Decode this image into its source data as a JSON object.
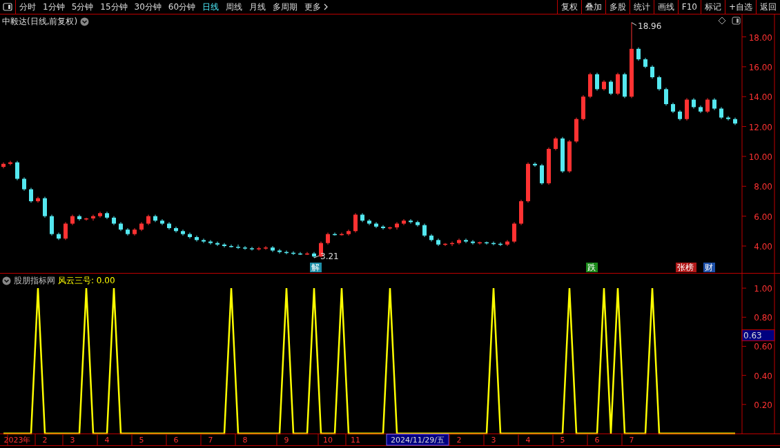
{
  "toolbar": {
    "periods": [
      {
        "label": "分时",
        "selected": false
      },
      {
        "label": "1分钟",
        "selected": false
      },
      {
        "label": "5分钟",
        "selected": false
      },
      {
        "label": "15分钟",
        "selected": false
      },
      {
        "label": "30分钟",
        "selected": false
      },
      {
        "label": "60分钟",
        "selected": false
      },
      {
        "label": "日线",
        "selected": true
      },
      {
        "label": "周线",
        "selected": false
      },
      {
        "label": "月线",
        "selected": false
      },
      {
        "label": "多周期",
        "selected": false
      }
    ],
    "more": "更多",
    "actions": [
      "复权",
      "叠加",
      "多股",
      "统计",
      "画线",
      "F10",
      "标记",
      "+自选",
      "返回"
    ]
  },
  "price_panel": {
    "title": "中毅达(日线,前复权)",
    "events": [
      {
        "text": "解",
        "color": "#1e8fa8"
      },
      {
        "text": "跌",
        "color": "#1a8a1a"
      },
      {
        "text": "张榜",
        "color": "#b01818"
      },
      {
        "text": "财",
        "color": "#1c4fa8"
      }
    ],
    "chart_data": {
      "type": "candlestick",
      "categories": [
        null,
        null,
        null,
        null,
        null,
        null,
        null,
        null,
        null,
        null,
        null,
        null,
        null,
        null,
        null,
        null,
        null,
        null,
        null,
        null,
        null,
        null,
        null,
        null,
        null,
        null,
        null,
        null,
        null,
        null,
        null,
        null,
        null,
        null,
        null,
        null,
        null,
        null,
        null,
        null,
        null,
        null,
        null,
        null,
        null,
        null,
        null,
        null,
        null,
        null,
        null,
        null,
        null,
        null,
        null,
        null,
        null,
        null,
        null,
        null,
        null,
        null,
        null,
        null,
        null,
        null,
        null,
        null,
        null,
        null,
        null,
        null,
        null,
        null,
        null,
        null,
        null,
        null,
        null,
        null,
        null,
        null,
        null,
        null,
        null,
        null,
        null,
        null,
        null,
        null,
        null,
        null,
        null,
        null,
        null,
        null,
        null,
        null,
        null,
        null,
        null,
        null,
        null,
        null,
        null,
        null,
        null
      ],
      "ohlc": [
        [
          9.3,
          9.6,
          9.2,
          9.5
        ],
        [
          9.5,
          9.7,
          9.4,
          9.6
        ],
        [
          9.6,
          9.7,
          8.4,
          8.5
        ],
        [
          8.5,
          8.6,
          7.7,
          7.8
        ],
        [
          7.8,
          7.9,
          6.9,
          7
        ],
        [
          7,
          7.3,
          6.9,
          7.2
        ],
        [
          7.2,
          7.3,
          5.9,
          6
        ],
        [
          6,
          6.1,
          4.7,
          4.8
        ],
        [
          4.8,
          4.9,
          4.4,
          4.5
        ],
        [
          4.5,
          5.6,
          4.4,
          5.5
        ],
        [
          5.5,
          6.1,
          5.4,
          6
        ],
        [
          6,
          6.1,
          5.7,
          5.8
        ],
        [
          5.8,
          5.9,
          5.7,
          5.85
        ],
        [
          5.85,
          6.1,
          5.7,
          6
        ],
        [
          6,
          6.3,
          5.9,
          6.2
        ],
        [
          6.2,
          6.3,
          5.8,
          5.9
        ],
        [
          5.9,
          6,
          5.4,
          5.5
        ],
        [
          5.5,
          5.6,
          5,
          5.1
        ],
        [
          5.1,
          5.2,
          4.7,
          4.8
        ],
        [
          4.8,
          5.2,
          4.7,
          5.1
        ],
        [
          5.1,
          5.6,
          5,
          5.5
        ],
        [
          5.5,
          6.1,
          5.4,
          6
        ],
        [
          6,
          6.1,
          5.6,
          5.7
        ],
        [
          5.7,
          5.8,
          5.4,
          5.5
        ],
        [
          5.5,
          5.6,
          5.1,
          5.2
        ],
        [
          5.2,
          5.3,
          4.9,
          5
        ],
        [
          5,
          5.1,
          4.7,
          4.8
        ],
        [
          4.8,
          4.9,
          4.5,
          4.6
        ],
        [
          4.6,
          4.7,
          4.3,
          4.4
        ],
        [
          4.4,
          4.5,
          4.2,
          4.3
        ],
        [
          4.3,
          4.4,
          4.1,
          4.2
        ],
        [
          4.2,
          4.3,
          4,
          4.1
        ],
        [
          4.1,
          4.2,
          3.9,
          4
        ],
        [
          4,
          4.1,
          3.9,
          3.95
        ],
        [
          3.95,
          4.1,
          3.8,
          3.9
        ],
        [
          3.9,
          4,
          3.75,
          3.85
        ],
        [
          3.85,
          3.95,
          3.7,
          3.8
        ],
        [
          3.8,
          3.95,
          3.7,
          3.85
        ],
        [
          3.85,
          4,
          3.75,
          3.9
        ],
        [
          3.9,
          4,
          3.6,
          3.7
        ],
        [
          3.7,
          3.8,
          3.5,
          3.6
        ],
        [
          3.6,
          3.7,
          3.45,
          3.55
        ],
        [
          3.55,
          3.65,
          3.4,
          3.5
        ],
        [
          3.5,
          3.6,
          3.4,
          3.45
        ],
        [
          3.45,
          3.6,
          3.4,
          3.5
        ],
        [
          3.5,
          3.6,
          3.21,
          3.3
        ],
        [
          3.3,
          4.3,
          3.25,
          4.2
        ],
        [
          4.2,
          4.9,
          4.1,
          4.8
        ],
        [
          4.8,
          4.9,
          4.7,
          4.75
        ],
        [
          4.75,
          4.9,
          4.7,
          4.8
        ],
        [
          4.8,
          5.1,
          4.7,
          5
        ],
        [
          5,
          6.2,
          4.9,
          6.1
        ],
        [
          6.1,
          6.2,
          5.6,
          5.7
        ],
        [
          5.7,
          5.8,
          5.4,
          5.5
        ],
        [
          5.5,
          5.6,
          5.2,
          5.3
        ],
        [
          5.3,
          5.4,
          5.1,
          5.2
        ],
        [
          5.2,
          5.3,
          5.1,
          5.25
        ],
        [
          5.25,
          5.6,
          5.1,
          5.5
        ],
        [
          5.5,
          5.8,
          5.4,
          5.7
        ],
        [
          5.7,
          5.8,
          5.5,
          5.6
        ],
        [
          5.6,
          5.7,
          5.3,
          5.4
        ],
        [
          5.4,
          5.5,
          4.6,
          4.7
        ],
        [
          4.7,
          4.8,
          4.3,
          4.4
        ],
        [
          4.4,
          4.5,
          4,
          4.1
        ],
        [
          4.1,
          4.2,
          4,
          4.15
        ],
        [
          4.15,
          4.3,
          4,
          4.2
        ],
        [
          4.2,
          4.5,
          4.1,
          4.4
        ],
        [
          4.4,
          4.5,
          4.2,
          4.3
        ],
        [
          4.3,
          4.4,
          4.1,
          4.2
        ],
        [
          4.2,
          4.3,
          4.1,
          4.25
        ],
        [
          4.25,
          4.3,
          4.1,
          4.2
        ],
        [
          4.2,
          4.3,
          4.05,
          4.15
        ],
        [
          4.15,
          4.25,
          4,
          4.1
        ],
        [
          4.1,
          4.4,
          4,
          4.3
        ],
        [
          4.3,
          5.6,
          4.2,
          5.5
        ],
        [
          5.5,
          7.1,
          5.4,
          7
        ],
        [
          7,
          9.6,
          6.9,
          9.5
        ],
        [
          9.5,
          9.6,
          9.3,
          9.4
        ],
        [
          9.4,
          9.5,
          8.1,
          8.2
        ],
        [
          8.2,
          10.6,
          8.1,
          10.5
        ],
        [
          10.5,
          11.3,
          10.4,
          11.2
        ],
        [
          11.2,
          11.3,
          8.9,
          9
        ],
        [
          9,
          11.1,
          8.9,
          11
        ],
        [
          11,
          12.6,
          10.9,
          12.5
        ],
        [
          12.5,
          14.1,
          12.4,
          14
        ],
        [
          14,
          15.6,
          13.9,
          15.5
        ],
        [
          15.5,
          15.6,
          14.4,
          14.5
        ],
        [
          14.5,
          15.1,
          14.4,
          15
        ],
        [
          15,
          15.1,
          14.1,
          14.2
        ],
        [
          14.2,
          15.6,
          14.1,
          15.5
        ],
        [
          15.5,
          15.6,
          13.9,
          14
        ],
        [
          14,
          18.96,
          13.9,
          17.2
        ],
        [
          17.2,
          17.3,
          16.4,
          16.5
        ],
        [
          16.5,
          16.6,
          15.9,
          16
        ],
        [
          16,
          16.1,
          15.2,
          15.3
        ],
        [
          15.3,
          15.4,
          14.4,
          14.5
        ],
        [
          14.5,
          14.6,
          13.4,
          13.5
        ],
        [
          13.5,
          13.6,
          12.9,
          13
        ],
        [
          13,
          13.1,
          12.4,
          12.5
        ],
        [
          12.5,
          13.9,
          12.4,
          13.8
        ],
        [
          13.8,
          13.9,
          13.2,
          13.3
        ],
        [
          13.3,
          13.4,
          12.9,
          13
        ],
        [
          13,
          13.9,
          12.9,
          13.8
        ],
        [
          13.8,
          13.9,
          13.1,
          13.2
        ],
        [
          13.2,
          13.3,
          12.5,
          12.6
        ],
        [
          12.6,
          12.7,
          12.4,
          12.5
        ],
        [
          12.5,
          12.6,
          12.1,
          12.2
        ]
      ],
      "ylim": [
        2.2,
        19.5
      ],
      "yticks": [
        {
          "value": 4,
          "label": "4.00"
        },
        {
          "value": 6,
          "label": "6.00"
        },
        {
          "value": 8,
          "label": "8.00"
        },
        {
          "value": 10,
          "label": "10.00"
        },
        {
          "value": 12,
          "label": "12.00"
        },
        {
          "value": 14,
          "label": "14.00"
        },
        {
          "value": 16,
          "label": "16.00"
        },
        {
          "value": 18,
          "label": "18.00"
        }
      ],
      "annotations": [
        {
          "text": "18.96"
        },
        {
          "text": "3.21"
        }
      ]
    }
  },
  "indicator_panel": {
    "source": "股朋指标网",
    "value_suffix": ": 0.00",
    "cursor_value": "0.63",
    "date_marks": [
      {
        "selected": false
      },
      {
        "selected": false
      },
      {
        "selected": false
      },
      {
        "selected": false
      },
      {
        "selected": false
      },
      {
        "selected": false
      },
      {
        "selected": false
      },
      {
        "selected": false
      },
      {
        "selected": false
      },
      {
        "selected": false
      },
      {
        "selected": false
      },
      {
        "selected": true
      },
      {
        "selected": false
      },
      {
        "selected": false
      },
      {
        "selected": false
      },
      {
        "selected": false
      },
      {
        "selected": false
      },
      {
        "selected": false
      }
    ],
    "chart_data": {
      "type": "line",
      "categories": [
        null,
        null,
        "2023年",
        null,
        null,
        null,
        "2",
        null,
        null,
        null,
        "3",
        null,
        null,
        null,
        null,
        "4",
        null,
        null,
        null,
        null,
        "5",
        null,
        null,
        null,
        null,
        "6",
        null,
        null,
        null,
        null,
        "7",
        null,
        null,
        null,
        null,
        "8",
        null,
        null,
        null,
        null,
        null,
        "9",
        null,
        null,
        null,
        null,
        null,
        "10",
        null,
        null,
        null,
        "11",
        null,
        null,
        null,
        null,
        null,
        null,
        null,
        null,
        "2024/11/29/五",
        null,
        null,
        null,
        null,
        null,
        "2",
        null,
        null,
        null,
        null,
        "3",
        null,
        null,
        null,
        null,
        "4",
        null,
        null,
        null,
        null,
        "5",
        null,
        null,
        null,
        null,
        "6",
        null,
        null,
        null,
        null,
        "7",
        null,
        null,
        null,
        null,
        null,
        null,
        null,
        null,
        null,
        null,
        null,
        null,
        null,
        null,
        null
      ],
      "series": [
        {
          "name": "风云三号",
          "color": "#ffff00",
          "values": [
            0,
            0,
            0,
            0,
            0,
            1,
            0,
            0,
            0,
            0,
            0,
            0,
            1,
            0,
            0,
            0,
            1,
            0,
            0,
            0,
            0,
            0,
            0,
            0,
            0,
            0,
            0,
            0,
            0,
            0,
            0,
            0,
            0,
            1,
            0,
            0,
            0,
            0,
            0,
            0,
            0,
            1,
            0,
            0,
            0,
            1,
            0,
            0,
            0,
            1,
            0,
            0,
            0,
            0,
            0,
            0,
            1,
            0,
            0,
            0,
            0,
            0,
            0,
            0,
            0,
            0,
            0,
            0,
            0,
            0,
            0,
            1,
            0,
            0,
            0,
            0,
            0,
            0,
            0,
            0,
            0,
            0,
            1,
            0,
            0,
            0,
            0,
            1,
            0,
            1,
            0,
            0,
            0,
            0,
            1,
            0,
            0,
            0,
            0,
            0,
            0,
            0,
            0,
            0,
            0,
            0,
            0
          ]
        }
      ],
      "ylim": [
        0,
        1.1
      ],
      "yticks": [
        {
          "value": 0.2,
          "label": "0.20"
        },
        {
          "value": 0.4,
          "label": "0.40"
        },
        {
          "value": 0.6,
          "label": "0.60"
        },
        {
          "value": 0.8,
          "label": "0.80"
        },
        {
          "value": 1,
          "label": "1.00"
        }
      ]
    }
  }
}
